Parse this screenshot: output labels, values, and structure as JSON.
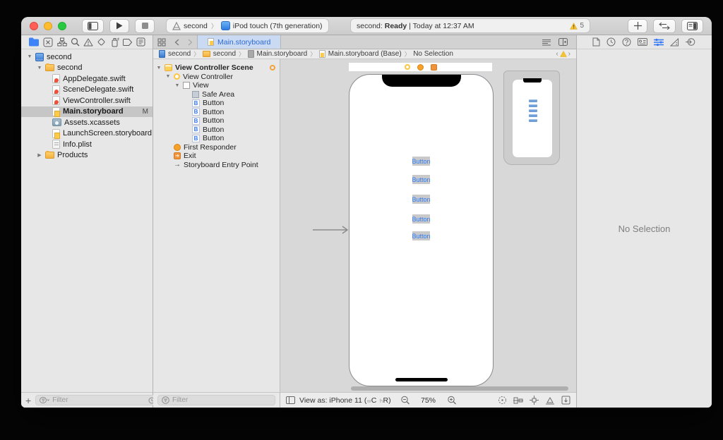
{
  "toolbar": {
    "scheme": {
      "project": "second",
      "device": "iPod touch (7th generation)"
    },
    "status": {
      "app": "second:",
      "state": "Ready",
      "sep": "|",
      "time": "Today at 12:37 AM",
      "warning_count": "5"
    }
  },
  "navigator": {
    "files": [
      {
        "label": "second"
      },
      {
        "label": "second"
      },
      {
        "label": "AppDelegate.swift"
      },
      {
        "label": "SceneDelegate.swift"
      },
      {
        "label": "ViewController.swift"
      },
      {
        "label": "Main.storyboard",
        "badge": "M"
      },
      {
        "label": "Assets.xcassets"
      },
      {
        "label": "LaunchScreen.storyboard"
      },
      {
        "label": "Info.plist"
      },
      {
        "label": "Products"
      }
    ],
    "filter_placeholder": "Filter"
  },
  "editor": {
    "tab_label": "Main.storyboard",
    "breadcrumbs": {
      "b0": "second",
      "b1": "second",
      "b2": "Main.storyboard",
      "b3": "Main.storyboard (Base)",
      "b4": "No Selection"
    }
  },
  "outline": {
    "scene": "View Controller Scene",
    "view_controller": "View Controller",
    "view": "View",
    "safe_area": "Safe Area",
    "buttons": [
      "Button",
      "Button",
      "Button",
      "Button",
      "Button"
    ],
    "first_responder": "First Responder",
    "exit": "Exit",
    "entry_point": "Storyboard Entry Point",
    "filter_placeholder": "Filter"
  },
  "canvas": {
    "buttons": [
      "Button",
      "Button",
      "Button",
      "Button",
      "Button"
    ],
    "view_as": {
      "pre": "View as: iPhone 11 (",
      "w": "w",
      "wc": "C",
      "h": "h",
      "hr": "R",
      "post": ")"
    },
    "zoom": "75%"
  },
  "inspector": {
    "empty": "No Selection"
  }
}
